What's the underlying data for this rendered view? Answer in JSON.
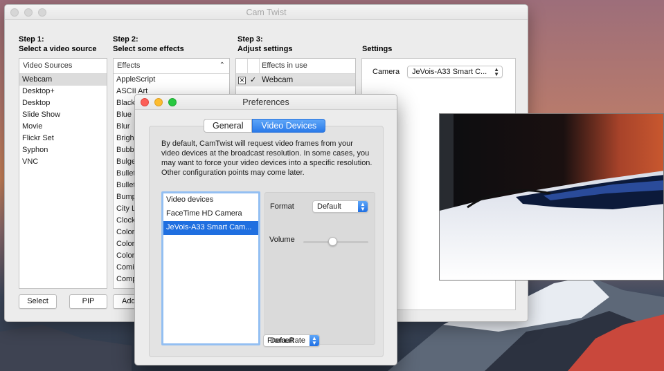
{
  "main_window": {
    "title": "Cam Twist",
    "step1": {
      "title": "Step 1:",
      "subtitle": "Select a video source"
    },
    "step2": {
      "title": "Step 2:",
      "subtitle": "Select some effects"
    },
    "step3": {
      "title": "Step 3:",
      "subtitle": "Adjust settings"
    },
    "settings_title": "Settings",
    "video_sources": {
      "header": "Video Sources",
      "items": [
        "Webcam",
        "Desktop+",
        "Desktop",
        "Slide Show",
        "Movie",
        "Flickr Set",
        "Syphon",
        "VNC"
      ],
      "selected": "Webcam"
    },
    "effects": {
      "header": "Effects",
      "items": [
        "AppleScript",
        "ASCII Art",
        "Black",
        "Blue F",
        "Blur",
        "Brigh",
        "Bubb",
        "Bulge",
        "Bullet",
        "Bullet",
        "Bump",
        "City L",
        "Clock",
        "Color",
        "Color",
        "Color",
        "Comic",
        "Comp"
      ]
    },
    "effects_in_use": {
      "header": "Effects in use",
      "items": [
        {
          "label": "Webcam",
          "remove": "✕",
          "check": "✓"
        }
      ]
    },
    "camera_label": "Camera",
    "camera_value": "JeVois-A33 Smart C...",
    "buttons": {
      "select": "Select",
      "pip": "PIP",
      "add": "Add"
    }
  },
  "preferences": {
    "title": "Preferences",
    "tabs": [
      "General",
      "Video Devices"
    ],
    "active_tab": "Video Devices",
    "description": "By default, CamTwist will request video frames from your video devices at the broadcast resolution.  In some cases, you may want to force your video devices into a specific resolution.  Other configuration points may come later.",
    "device_list": {
      "items": [
        "Video devices",
        "FaceTime HD Camera",
        "JeVois-A33 Smart Cam..."
      ],
      "selected": "JeVois-A33 Smart Cam..."
    },
    "format_label": "Format",
    "format_value": "Default",
    "volume_label": "Volume",
    "volume_level": 0.45,
    "framerate_overlap_text": "FrameRate",
    "framerate_value": "Default"
  },
  "colors": {
    "accent": "#1f6fe0",
    "selection_grey": "#dcdcdc"
  }
}
